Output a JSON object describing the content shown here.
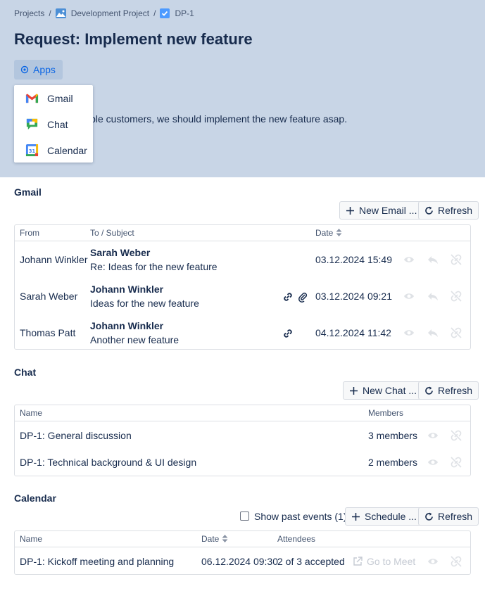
{
  "breadcrumb": {
    "projects": "Projects",
    "project": "Development Project",
    "issue": "DP-1"
  },
  "page_title": "Request: Implement new feature",
  "apps_button": "Apps",
  "apps_menu": [
    {
      "label": "Gmail",
      "icon": "gmail-icon"
    },
    {
      "label": "Chat",
      "icon": "chat-icon"
    },
    {
      "label": "Calendar",
      "icon": "calendar-icon"
    }
  ],
  "description_visible": "ltiple customers, we should implement the new feature asap.",
  "gmail": {
    "title": "Gmail",
    "new_button": "New Email ...",
    "refresh_button": "Refresh",
    "columns": {
      "from": "From",
      "to_subject": "To / Subject",
      "date": "Date"
    },
    "rows": [
      {
        "from": "Johann Winkler",
        "to": "Sarah Weber",
        "subject": "Re: Ideas for the new feature",
        "date": "03.12.2024 15:49",
        "link": false,
        "attachment": false
      },
      {
        "from": "Sarah Weber",
        "to": "Johann Winkler",
        "subject": "Ideas for the new feature",
        "date": "03.12.2024 09:21",
        "link": true,
        "attachment": true
      },
      {
        "from": "Thomas Patt",
        "to": "Johann Winkler",
        "subject": "Another new feature",
        "date": "04.12.2024 11:42",
        "link": true,
        "attachment": false
      }
    ]
  },
  "chat": {
    "title": "Chat",
    "new_button": "New Chat ...",
    "refresh_button": "Refresh",
    "columns": {
      "name": "Name",
      "members": "Members"
    },
    "rows": [
      {
        "name": "DP-1: General discussion",
        "members": "3 members"
      },
      {
        "name": "DP-1: Technical background & UI design",
        "members": "2 members"
      }
    ]
  },
  "calendar": {
    "title": "Calendar",
    "show_past": "Show past events (1)",
    "schedule_button": "Schedule ...",
    "refresh_button": "Refresh",
    "columns": {
      "name": "Name",
      "date": "Date",
      "attendees": "Attendees"
    },
    "rows": [
      {
        "name": "DP-1: Kickoff meeting and planning",
        "date": "06.12.2024 09:30",
        "attendees": "2 of 3 accepted",
        "go_to_meet": "Go to Meet"
      }
    ]
  },
  "colors": {
    "hero": "#c8d5e6",
    "accent": "#0c66e4",
    "text": "#172b4d"
  }
}
